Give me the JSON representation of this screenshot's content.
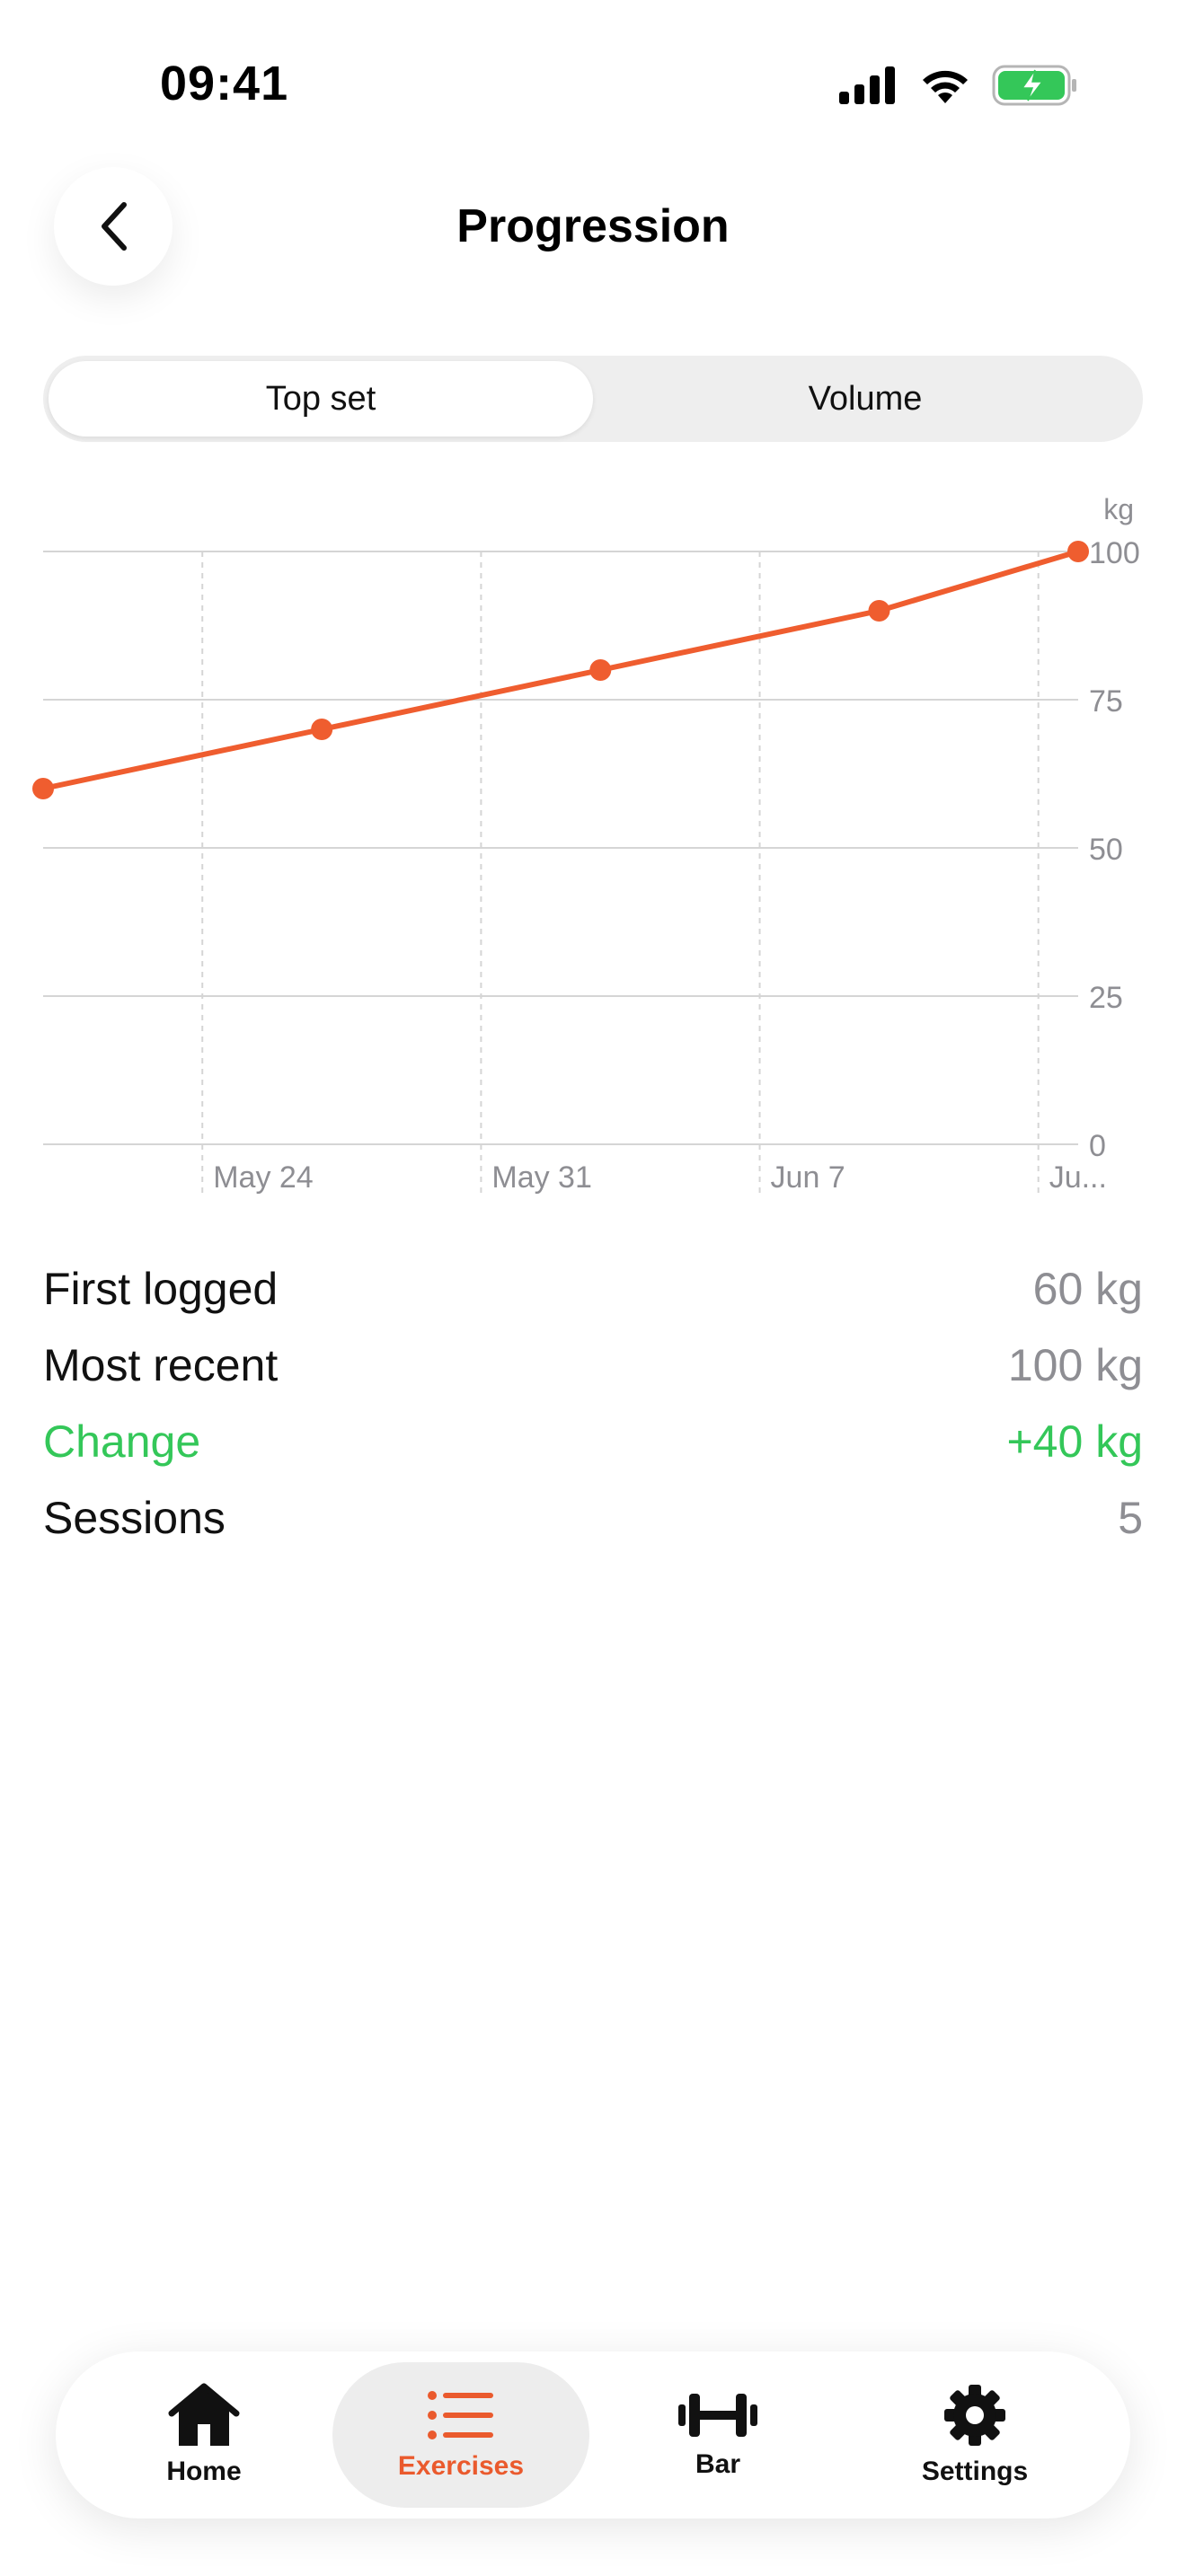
{
  "status_bar": {
    "time": "09:41"
  },
  "header": {
    "title": "Progression"
  },
  "segments": {
    "top_set": "Top set",
    "volume": "Volume"
  },
  "chart_data": {
    "type": "line",
    "x": [
      "May 20",
      "May 27",
      "Jun 3",
      "Jun 10",
      "Jun 15"
    ],
    "series": [
      {
        "values": [
          60,
          70,
          80,
          90,
          100
        ]
      }
    ],
    "x_tick_labels": [
      "May 24",
      "May 31",
      "Jun 7",
      "Ju..."
    ],
    "y_ticks": [
      0,
      25,
      50,
      75,
      100
    ],
    "y_unit": "kg",
    "ylim": [
      0,
      100
    ],
    "y_axis_position": "right",
    "grid": true,
    "line_color": "#ef5d2f"
  },
  "stats": {
    "first_logged": {
      "label": "First logged",
      "value": "60 kg"
    },
    "most_recent": {
      "label": "Most recent",
      "value": "100 kg"
    },
    "change": {
      "label": "Change",
      "value": "+40 kg",
      "color": "#34c759"
    },
    "sessions": {
      "label": "Sessions",
      "value": "5"
    }
  },
  "tab_bar": {
    "accent": "#ea5a2d",
    "tabs": [
      {
        "label": "Home",
        "icon": "house-icon"
      },
      {
        "label": "Exercises",
        "icon": "list-icon"
      },
      {
        "label": "Bar",
        "icon": "barbell-icon"
      },
      {
        "label": "Settings",
        "icon": "gear-icon"
      }
    ]
  }
}
